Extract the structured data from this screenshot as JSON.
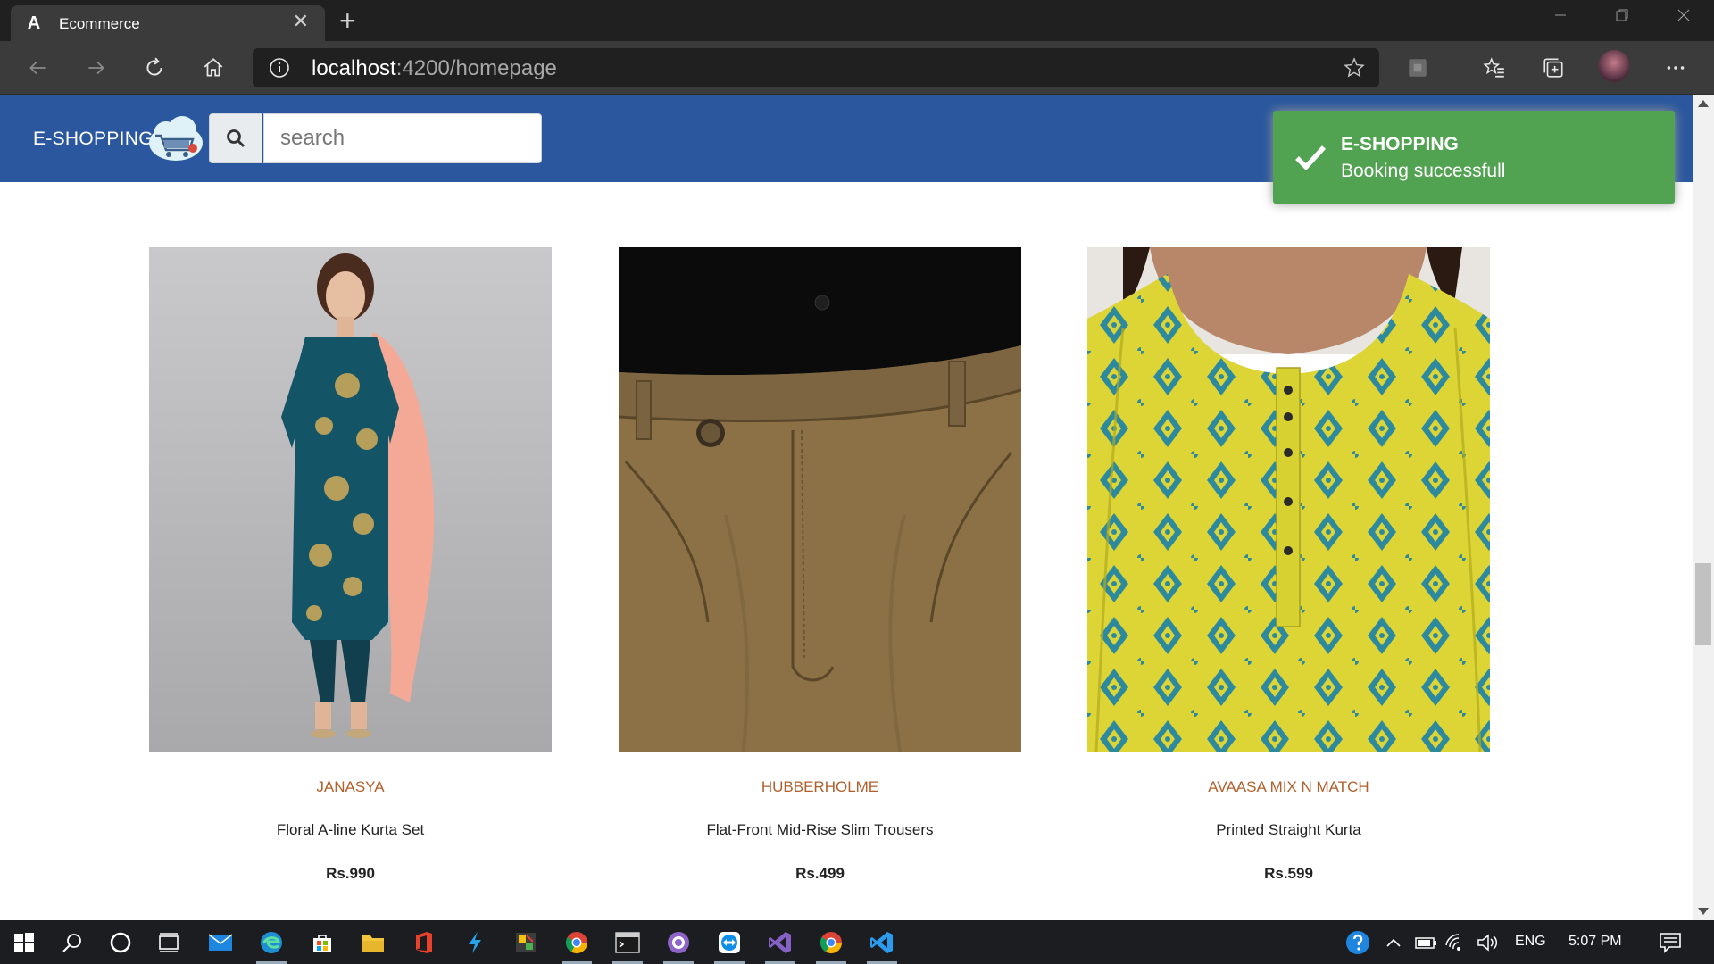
{
  "browser": {
    "tab_title": "Ecommerce",
    "favicon_letter": "A",
    "tab_close": "✕",
    "new_tab": "+",
    "url_host": "localhost",
    "url_rest": ":4200/homepage"
  },
  "header": {
    "brand": "E-SHOPPING",
    "search_placeholder": "search"
  },
  "toast": {
    "title": "E-SHOPPING",
    "message": "Booking successfull",
    "color": "#51a351"
  },
  "products": [
    {
      "brand": "JANASYA",
      "name": "Floral A-line Kurta Set",
      "price": "Rs.990"
    },
    {
      "brand": "HUBBERHOLME",
      "name": "Flat-Front Mid-Rise Slim Trousers",
      "price": "Rs.499"
    },
    {
      "brand": "AVAASA MIX N MATCH",
      "name": "Printed Straight Kurta",
      "price": "Rs.599"
    }
  ],
  "taskbar": {
    "language": "ENG",
    "time": "5:07 PM"
  },
  "colors": {
    "header_bg": "#2a579e",
    "brand_text": "#b0602c"
  }
}
